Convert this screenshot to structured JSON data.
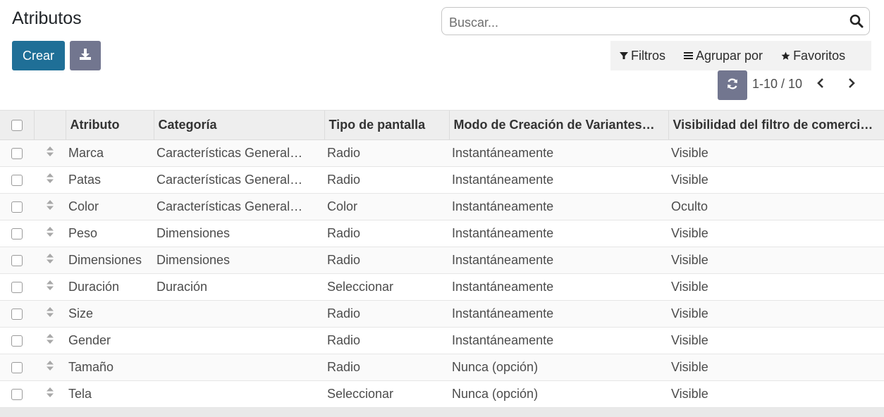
{
  "page": {
    "title": "Atributos",
    "create_label": "Crear",
    "download_icon": "download-icon"
  },
  "search": {
    "placeholder": "Buscar..."
  },
  "filters": {
    "filters_label": "Filtros",
    "group_by_label": "Agrupar por",
    "favorites_label": "Favoritos"
  },
  "pager": {
    "value": "1-10 / 10"
  },
  "table": {
    "headers": {
      "attribute": "Atributo",
      "category": "Categoría",
      "display_type": "Tipo de pantalla",
      "variant_mode": "Modo de Creación de Variantes…",
      "visibility": "Visibilidad del filtro de comerci…"
    },
    "rows": [
      {
        "attribute": "Marca",
        "category": "Características General…",
        "display_type": "Radio",
        "variant_mode": "Instantáneamente",
        "visibility": "Visible"
      },
      {
        "attribute": "Patas",
        "category": "Características General…",
        "display_type": "Radio",
        "variant_mode": "Instantáneamente",
        "visibility": "Visible"
      },
      {
        "attribute": "Color",
        "category": "Características General…",
        "display_type": "Color",
        "variant_mode": "Instantáneamente",
        "visibility": "Oculto"
      },
      {
        "attribute": "Peso",
        "category": "Dimensiones",
        "display_type": "Radio",
        "variant_mode": "Instantáneamente",
        "visibility": "Visible"
      },
      {
        "attribute": "Dimensiones",
        "category": "Dimensiones",
        "display_type": "Radio",
        "variant_mode": "Instantáneamente",
        "visibility": "Visible"
      },
      {
        "attribute": "Duración",
        "category": "Duración",
        "display_type": "Seleccionar",
        "variant_mode": "Instantáneamente",
        "visibility": "Visible"
      },
      {
        "attribute": "Size",
        "category": "",
        "display_type": "Radio",
        "variant_mode": "Instantáneamente",
        "visibility": "Visible"
      },
      {
        "attribute": "Gender",
        "category": "",
        "display_type": "Radio",
        "variant_mode": "Instantáneamente",
        "visibility": "Visible"
      },
      {
        "attribute": "Tamaño",
        "category": "",
        "display_type": "Radio",
        "variant_mode": "Nunca (opción)",
        "visibility": "Visible"
      },
      {
        "attribute": "Tela",
        "category": "",
        "display_type": "Seleccionar",
        "variant_mode": "Nunca (opción)",
        "visibility": "Visible"
      }
    ]
  },
  "colors": {
    "primary": "#1f6f97",
    "secondary": "#72768f",
    "header_bg": "#eeeeee"
  }
}
